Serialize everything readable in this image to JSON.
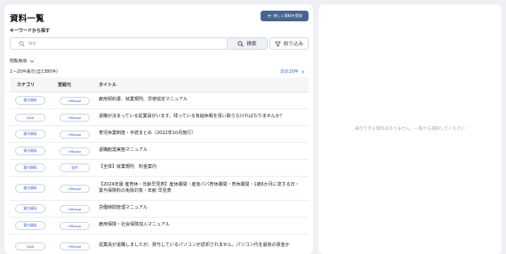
{
  "left": {
    "title": "資料一覧",
    "register_button": "新しく資料を登録",
    "keyword_label": "キーワードから探す",
    "search": {
      "placeholder": "検索",
      "button": "検索"
    },
    "filter_button": "絞り込み",
    "sort_label": "閲覧数順",
    "count_text": "1～20件表示(全1380件)",
    "next_link": "次の20件",
    "table": {
      "headers": {
        "category": "カテゴリ",
        "registrant": "登録元",
        "title": "タイトル"
      },
      "rows": [
        {
          "category": "案内資料",
          "registrant": "HRbase",
          "title": "雇用契約書、就業規則、労使協定マニュアル"
        },
        {
          "category": "Q&A",
          "registrant": "HRbase",
          "title": "退職が決まっている従業員がいます。残っている有給休暇を買い取らなければなりませんか？"
        },
        {
          "category": "案内資料",
          "registrant": "HRbase",
          "title": "育児休業制度・手続まとめ（2022年10月施行）"
        },
        {
          "category": "案内資料",
          "registrant": "HRbase",
          "title": "退職勧奨実施マニュアル"
        },
        {
          "category": "案内資料",
          "registrant": "自社",
          "title": "【全体】就業規則　料金案内"
        },
        {
          "category": "案内資料",
          "registrant": "HRbase",
          "title": "【2024年版 産育休・年齢早見表】産休期間・産後パパ育休期間・育休期間・1歳6か月に達する日・賞与保険料の免除対象・年齢 早見表"
        },
        {
          "category": "案内資料",
          "registrant": "HRbase",
          "title": "労働時間管理マニュアル"
        },
        {
          "category": "案内資料",
          "registrant": "HRbase",
          "title": "雇用保険・社会保険加入マニュアル"
        },
        {
          "category": "Q&A",
          "registrant": "HRbase",
          "title": "従業員が退職しましたが、貸与しているパソコンが返却されません。パソコン代を最後の賃金か"
        }
      ]
    }
  },
  "right": {
    "empty_message": "表示できる資料はありません。一覧から選択してください"
  }
}
